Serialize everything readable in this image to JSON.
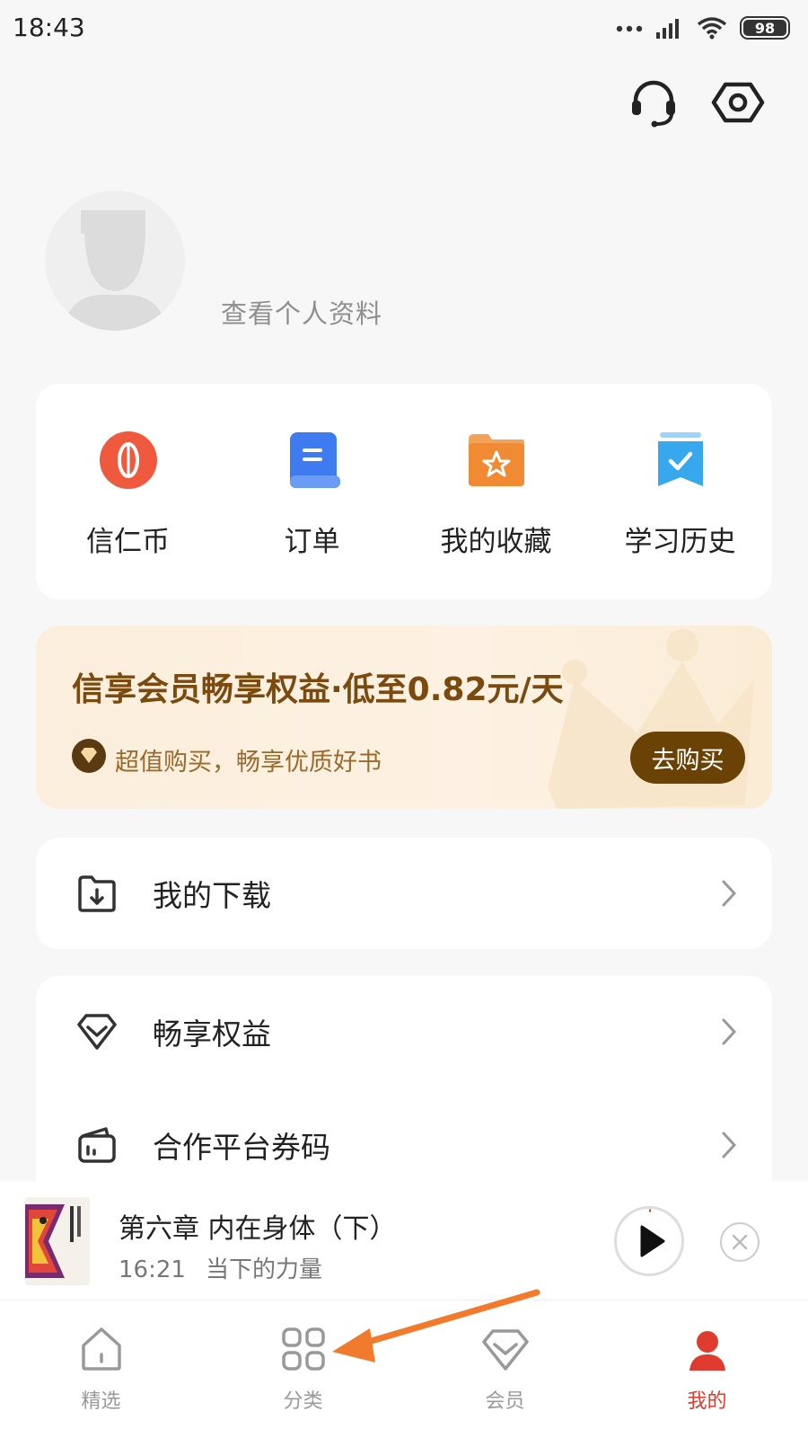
{
  "status_bar": {
    "time": "18:43",
    "battery": "98"
  },
  "header": {
    "support_icon": "headset-icon",
    "settings_icon": "settings-icon"
  },
  "profile": {
    "link_text": "查看个人资料"
  },
  "quick_actions": [
    {
      "label": "信仁币",
      "icon": "coin-icon",
      "color": "#f0573e"
    },
    {
      "label": "订单",
      "icon": "order-icon",
      "color": "#3e7bf0"
    },
    {
      "label": "我的收藏",
      "icon": "favorites-icon",
      "color": "#f08a33"
    },
    {
      "label": "学习历史",
      "icon": "history-icon",
      "color": "#38a8ee"
    }
  ],
  "vip_banner": {
    "title": "信享会员畅享权益·低至0.82元/天",
    "subtitle": "超值购买，畅享优质好书",
    "button": "去购买"
  },
  "menu": {
    "download": "我的下载",
    "rights": "畅享权益",
    "coupon": "合作平台券码"
  },
  "player": {
    "title": "第六章 内在身体（下）",
    "time": "16:21",
    "book": "当下的力量"
  },
  "bottom_nav": [
    {
      "label": "精选",
      "icon": "home-icon"
    },
    {
      "label": "分类",
      "icon": "category-icon"
    },
    {
      "label": "会员",
      "icon": "vip-icon"
    },
    {
      "label": "我的",
      "icon": "profile-icon"
    }
  ],
  "colors": {
    "accent": "#e03b2f",
    "vip_dark": "#6a4206"
  }
}
